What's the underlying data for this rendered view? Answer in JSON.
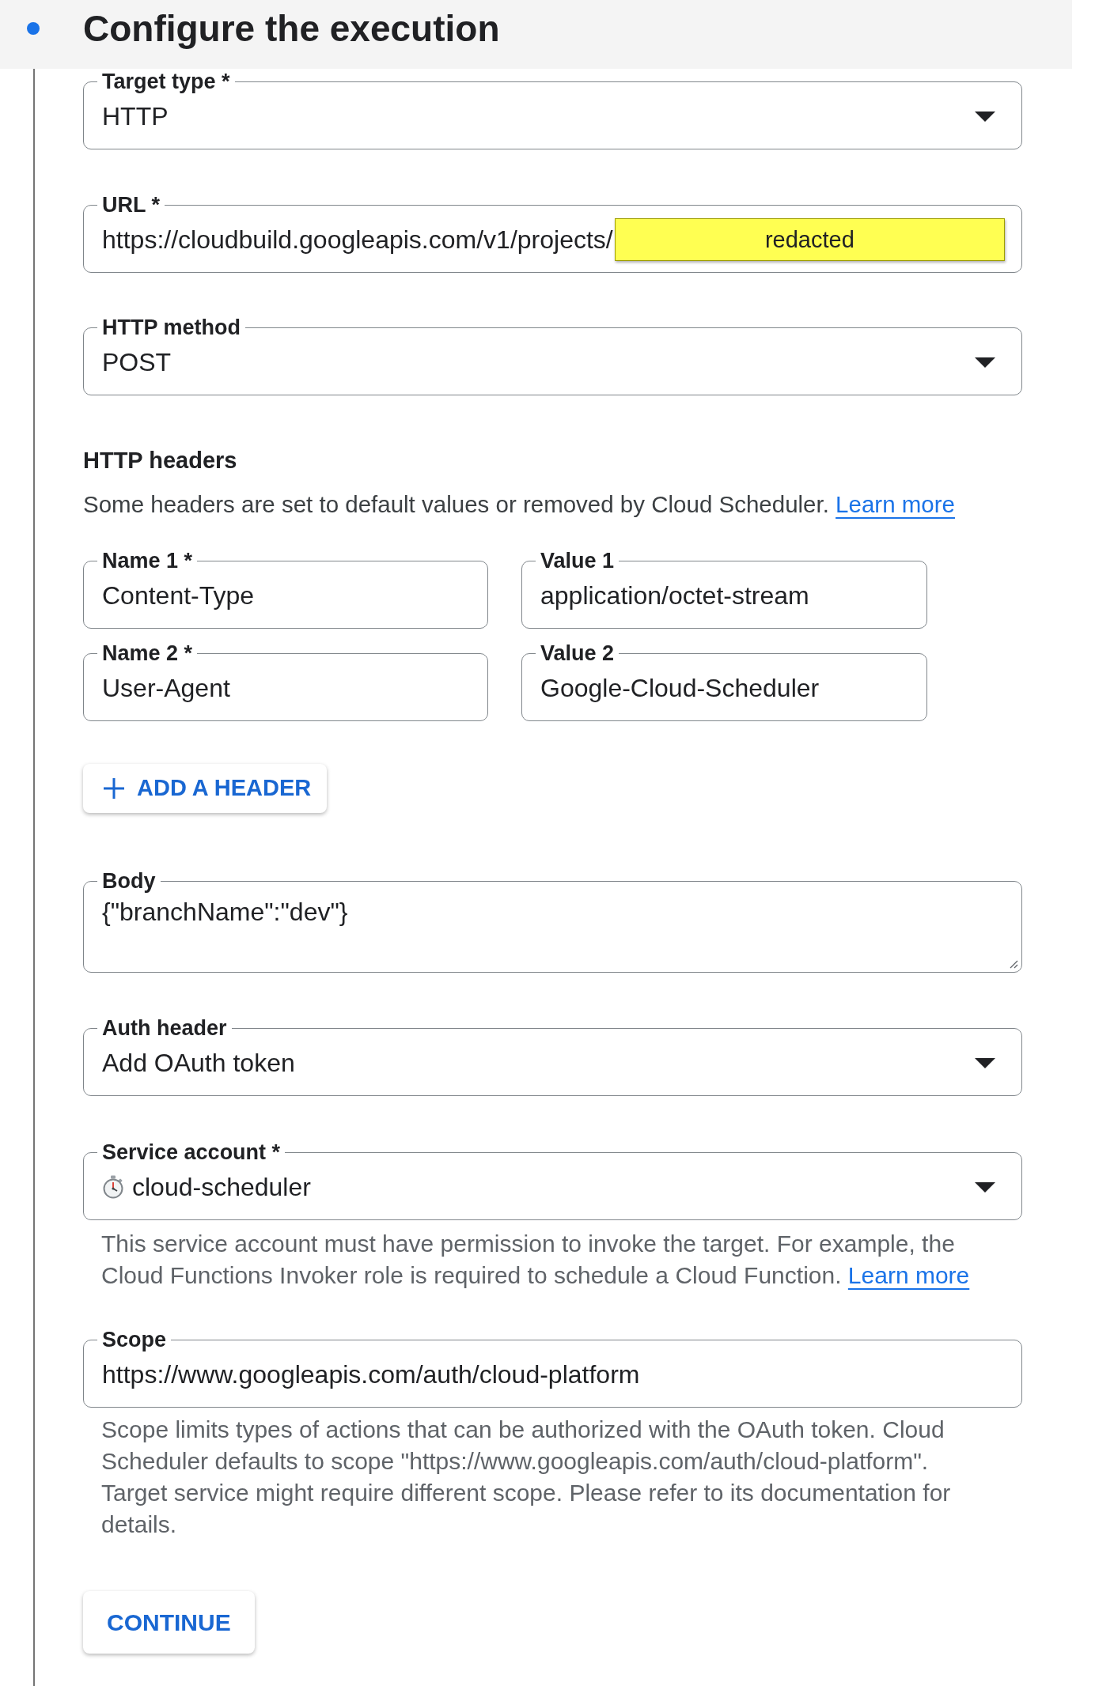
{
  "step": {
    "title": "Configure the execution"
  },
  "fields_top": [
    {
      "kind": "select",
      "label": "Target type *",
      "value": "HTTP"
    },
    {
      "kind": "text",
      "label": "URL *",
      "value": "https://cloudbuild.googleapis.com/v1/projects/",
      "redaction": "redacted"
    },
    {
      "kind": "select",
      "label": "HTTP method",
      "value": "POST"
    }
  ],
  "http_headers": {
    "title": "HTTP headers",
    "description": "Some headers are set to default values or removed by Cloud Scheduler.",
    "link": "Learn more",
    "rows": [
      {
        "name_label": "Name 1 *",
        "name": "Content-Type",
        "value_label": "Value 1",
        "value": "application/octet-stream"
      },
      {
        "name_label": "Name 2 *",
        "name": "User-Agent",
        "value_label": "Value 2",
        "value": "Google-Cloud-Scheduler"
      }
    ],
    "add_button": "ADD A HEADER"
  },
  "fields_bottom": [
    {
      "kind": "textarea",
      "label": "Body",
      "value": "{\"branchName\":\"dev\"}"
    },
    {
      "kind": "select",
      "label": "Auth header",
      "value": "Add OAuth token"
    },
    {
      "kind": "account-select",
      "label": "Service account *",
      "value": "cloud-scheduler",
      "helper": "This service account must have permission to invoke the target. For example, the Cloud Functions Invoker role is required to schedule a Cloud Function.",
      "helper_link": "Learn more"
    },
    {
      "kind": "text",
      "label": "Scope",
      "value": "https://www.googleapis.com/auth/cloud-platform",
      "helper": "Scope limits types of actions that can be authorized with the OAuth token. Cloud Scheduler defaults to scope \"https://www.googleapis.com/auth/cloud-platform\". Target service might require different scope. Please refer to its documentation for details."
    }
  ],
  "continue_button": "CONTINUE"
}
